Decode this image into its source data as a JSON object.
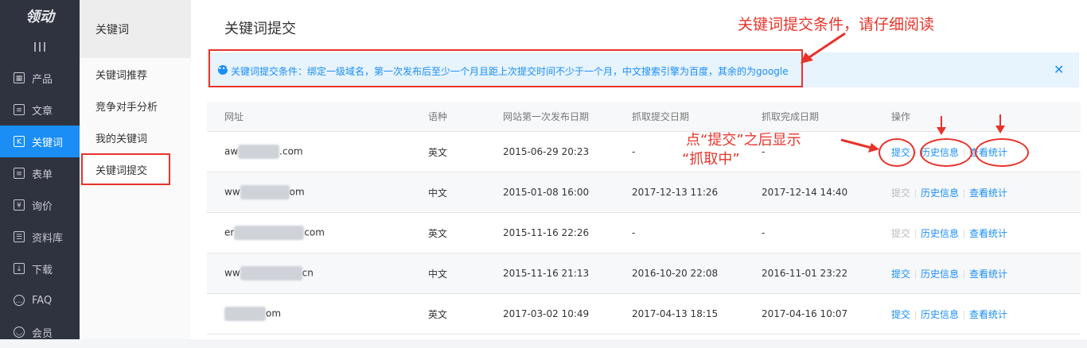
{
  "logo": "领动",
  "nav": [
    {
      "label": "产品",
      "icon": "grid-icon"
    },
    {
      "label": "文章",
      "icon": "doc-icon"
    },
    {
      "label": "关键词",
      "icon": "k-icon"
    },
    {
      "label": "表单",
      "icon": "form-icon"
    },
    {
      "label": "询价",
      "icon": "quote-icon"
    },
    {
      "label": "资料库",
      "icon": "library-icon"
    },
    {
      "label": "下载",
      "icon": "download-icon"
    },
    {
      "label": "FAQ",
      "icon": "faq-icon"
    },
    {
      "label": "会员",
      "icon": "member-icon"
    }
  ],
  "subnav": {
    "title": "关键词",
    "items": [
      "关键词推荐",
      "竞争对手分析",
      "我的关键词",
      "关键词提交"
    ]
  },
  "main": {
    "title": "关键词提交",
    "notice": "关键词提交条件：绑定一级域名，第一次发布后至少一个月且距上次提交时间不少于一个月，中文搜索引擎为百度，其余的为google",
    "headers": [
      "网址",
      "语种",
      "网站第一次发布日期",
      "抓取提交日期",
      "抓取完成日期",
      "操作"
    ],
    "rows": [
      {
        "url_a": "aw",
        "url_b": ".com",
        "lang": "英文",
        "pub": "2015-06-29 20:23",
        "sub": "-",
        "done": "-",
        "submit": "提交",
        "history": "历史信息",
        "stats": "查看统计"
      },
      {
        "url_a": "ww",
        "url_b": "om",
        "lang": "中文",
        "pub": "2015-01-08 16:00",
        "sub": "2017-12-13 11:26",
        "done": "2017-12-14 14:40",
        "submit": "提交",
        "history": "历史信息",
        "stats": "查看统计"
      },
      {
        "url_a": "er",
        "url_b": "com",
        "lang": "英文",
        "pub": "2015-11-16 22:26",
        "sub": "-",
        "done": "-",
        "submit": "提交",
        "history": "历史信息",
        "stats": "查看统计"
      },
      {
        "url_a": "ww",
        "url_b": "cn",
        "lang": "中文",
        "pub": "2015-11-16 21:13",
        "sub": "2016-10-20 22:08",
        "done": "2016-11-01 23:22",
        "submit": "提交",
        "history": "历史信息",
        "stats": "查看统计"
      },
      {
        "url_a": "",
        "url_b": "om",
        "lang": "英文",
        "pub": "2017-03-02 10:49",
        "sub": "2017-04-13 18:15",
        "done": "2017-04-16 10:07",
        "submit": "提交",
        "history": "历史信息",
        "stats": "查看统计"
      }
    ]
  },
  "annotations": {
    "top": "关键词提交条件，请仔细阅读",
    "mid_line1": "点“提交”之后显示",
    "mid_line2": "“抓取中”"
  },
  "colors": {
    "accent": "#1a8ef5",
    "sidebar": "#2f3340",
    "annotation": "#e8332a"
  }
}
